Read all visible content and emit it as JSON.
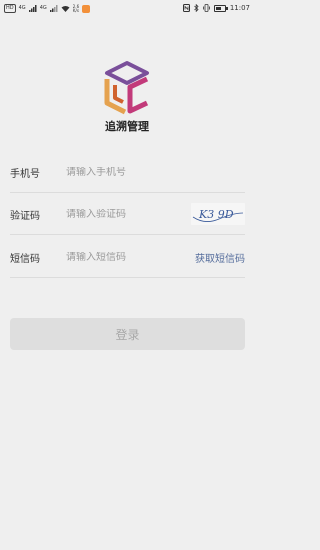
{
  "status_bar": {
    "sim_label": "HD",
    "network_1": "4G",
    "network_2": "4G",
    "speed_value": "2.6",
    "speed_unit": "K/s",
    "time": "11:07",
    "battery_level": 0.6
  },
  "app": {
    "title": "追溯管理",
    "logo_colors": [
      "#e5a24f",
      "#7a4f9a",
      "#c23a7a",
      "#d0622e"
    ]
  },
  "form": {
    "phone": {
      "label": "手机号",
      "placeholder": "请输入手机号"
    },
    "captcha": {
      "label": "验证码",
      "placeholder": "请输入验证码",
      "image_text": "K3 9D"
    },
    "sms": {
      "label": "短信码",
      "placeholder": "请输入短信码",
      "action": "获取短信码"
    }
  },
  "login_button": "登录"
}
